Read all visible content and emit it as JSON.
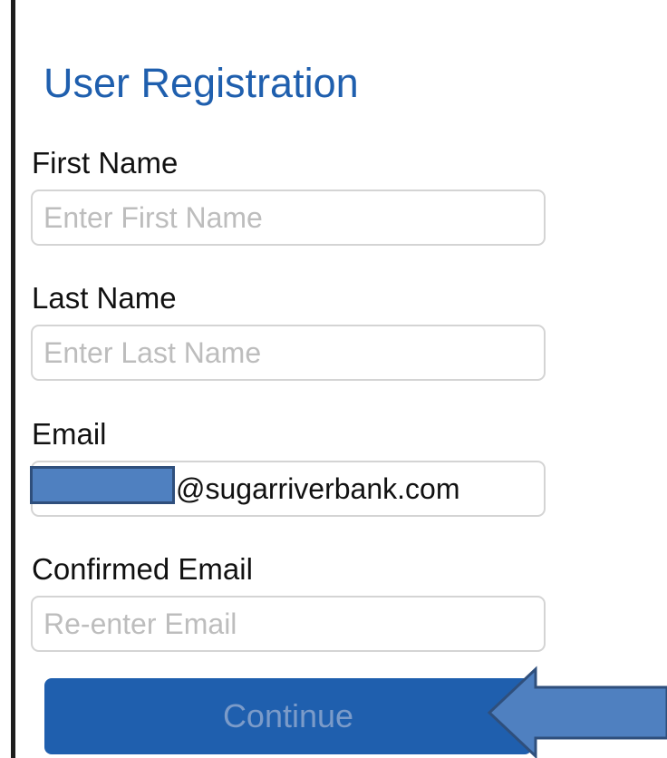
{
  "page": {
    "title": "User Registration"
  },
  "form": {
    "first_name": {
      "label": "First Name",
      "placeholder": "Enter First Name",
      "value": ""
    },
    "last_name": {
      "label": "Last Name",
      "placeholder": "Enter Last Name",
      "value": ""
    },
    "email": {
      "label": "Email",
      "placeholder": "",
      "value": "@sugarriverbank.com"
    },
    "confirmed_email": {
      "label": "Confirmed Email",
      "placeholder": "Re-enter Email",
      "value": ""
    },
    "continue_label": "Continue"
  },
  "colors": {
    "accent": "#1f5fae",
    "button_text": "#7b9bc9",
    "redaction_fill": "#4f80c0",
    "arrow_fill": "#4f80c0",
    "arrow_stroke": "#2f4f7c"
  }
}
